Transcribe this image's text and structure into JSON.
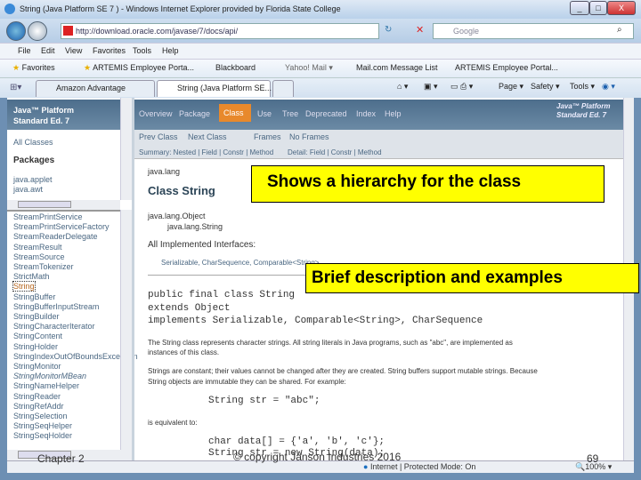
{
  "window": {
    "title": "String (Java Platform SE 7 ) - Windows Internet Explorer provided by Florida State College",
    "controls": [
      "_",
      "□",
      "X"
    ]
  },
  "address": {
    "url": "http://download.oracle.com/javase/7/docs/api/",
    "search_placeholder": "Google"
  },
  "menu": [
    "File",
    "Edit",
    "View",
    "Favorites",
    "Tools",
    "Help"
  ],
  "favorites": {
    "label": "Favorites",
    "items": [
      "ARTEMIS Employee Porta...",
      "Blackboard",
      "Yahoo! Mail ▾",
      "Mail.com Message List",
      "ARTEMIS Employee Portal..."
    ]
  },
  "tabs": [
    "Amazon Advantage",
    "String (Java Platform SE... ✕"
  ],
  "toolbar": {
    "page": "Page ▾",
    "safety": "Safety ▾",
    "tools": "Tools ▾"
  },
  "left": {
    "header": [
      "Java™ Platform",
      "Standard Ed. 7"
    ],
    "all_classes": "All Classes",
    "packages_heading": "Packages",
    "packages": [
      "java.applet",
      "java.awt"
    ],
    "classes": [
      "StreamPrintService",
      "StreamPrintServiceFactory",
      "StreamReaderDelegate",
      "StreamResult",
      "StreamSource",
      "StreamTokenizer",
      "StrictMath",
      "String",
      "StringBuffer",
      "StringBufferInputStream",
      "StringBuilder",
      "StringCharacterIterator",
      "StringContent",
      "StringHolder",
      "StringIndexOutOfBoundsException",
      "StringMonitor",
      "StringMonitorMBean",
      "StringNameHelper",
      "StringReader",
      "StringRefAddr",
      "StringSelection",
      "StringSeqHelper",
      "StringSeqHolder"
    ]
  },
  "main": {
    "nav": [
      "Overview",
      "Package",
      "Class",
      "Use",
      "Tree",
      "Deprecated",
      "Index",
      "Help"
    ],
    "nav_active": "Class",
    "brand": [
      "Java™ Platform",
      "Standard Ed. 7"
    ],
    "subnav1": [
      "Prev Class",
      "Next Class",
      "Frames",
      "No Frames"
    ],
    "summary": "Summary: Nested | Field | Constr | Method",
    "detail": "Detail: Field | Constr | Method",
    "package": "java.lang",
    "class_title": "Class String",
    "hier1": "java.lang.Object",
    "hier2": "java.lang.String",
    "interfaces_heading": "All Implemented Interfaces:",
    "interfaces": "Serializable, CharSequence, Comparable<String>",
    "decl": [
      "public final class String",
      "extends Object",
      "implements Serializable, Comparable<String>, CharSequence"
    ],
    "desc1a": "The String class represents character strings. All string literals in Java programs, such as \"abc\", are implemented as",
    "desc1b": "instances of this class.",
    "desc2a": "Strings are constant; their values cannot be changed after they are created. String buffers support mutable strings. Because",
    "desc2b": "String objects are immutable they can be shared. For example:",
    "code1": "String str = \"abc\";",
    "equiv": "is equivalent to:",
    "code2": "char data[] = {'a', 'b', 'c'};",
    "code3": "String str = new String(data);"
  },
  "status": {
    "zone": "Internet | Protected Mode: On",
    "zoom": "100%"
  },
  "callouts": {
    "hierarchy": "Shows a hierarchy for the class",
    "description": "Brief description and examples"
  },
  "slide": {
    "chapter": "Chapter 2",
    "copyright": "© copyright Janson Industries 2016",
    "page": "69"
  },
  "colors": {
    "callout": "#ffff00",
    "nav_bg": "#4d6e8c",
    "active_tab": "#e8892c"
  }
}
